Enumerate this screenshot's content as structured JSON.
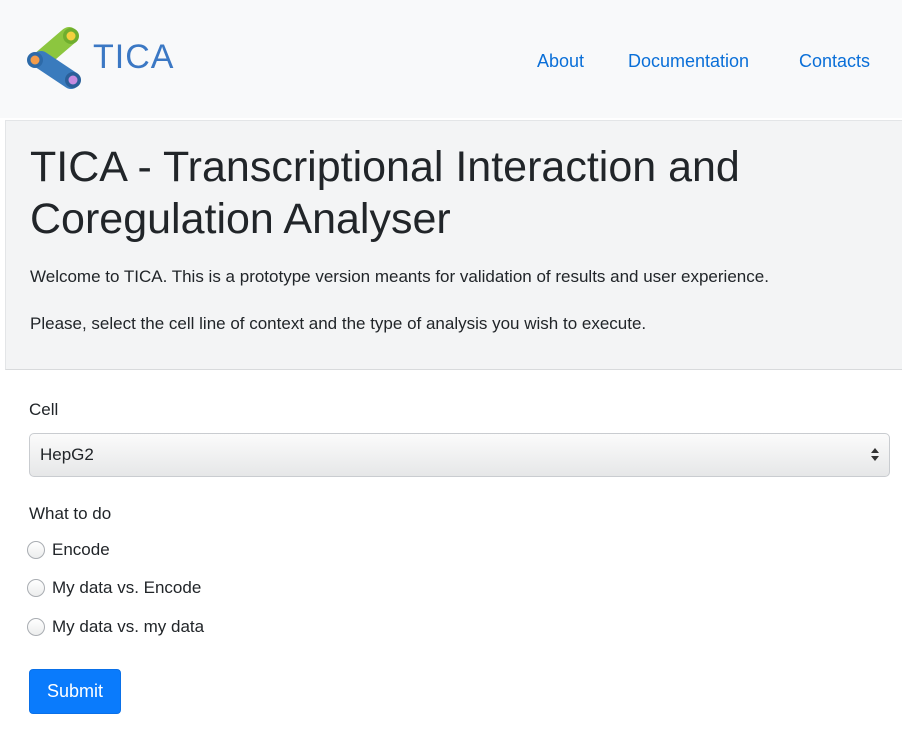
{
  "navbar": {
    "brand": "TICA",
    "links": [
      "About",
      "Documentation",
      "Contacts"
    ]
  },
  "jumbotron": {
    "title": "TICA - Transcriptional Interaction and Coregulation Analyser",
    "lead1": "Welcome to TICA. This is a prototype version meants for validation of results and user experience.",
    "lead2": "Please, select the cell line of context and the type of analysis you wish to execute."
  },
  "form": {
    "cell_label": "Cell",
    "cell_value": "HepG2",
    "what_label": "What to do",
    "options": [
      "Encode",
      "My data vs. Encode",
      "My data vs. my data"
    ],
    "submit_label": "Submit"
  },
  "colors": {
    "link": "#0a6fd8",
    "button": "#0a7bfc",
    "navbar_bg": "#f8f9fa",
    "jumbotron_bg": "#f3f4f5",
    "logo_text": "#3b78c4"
  }
}
